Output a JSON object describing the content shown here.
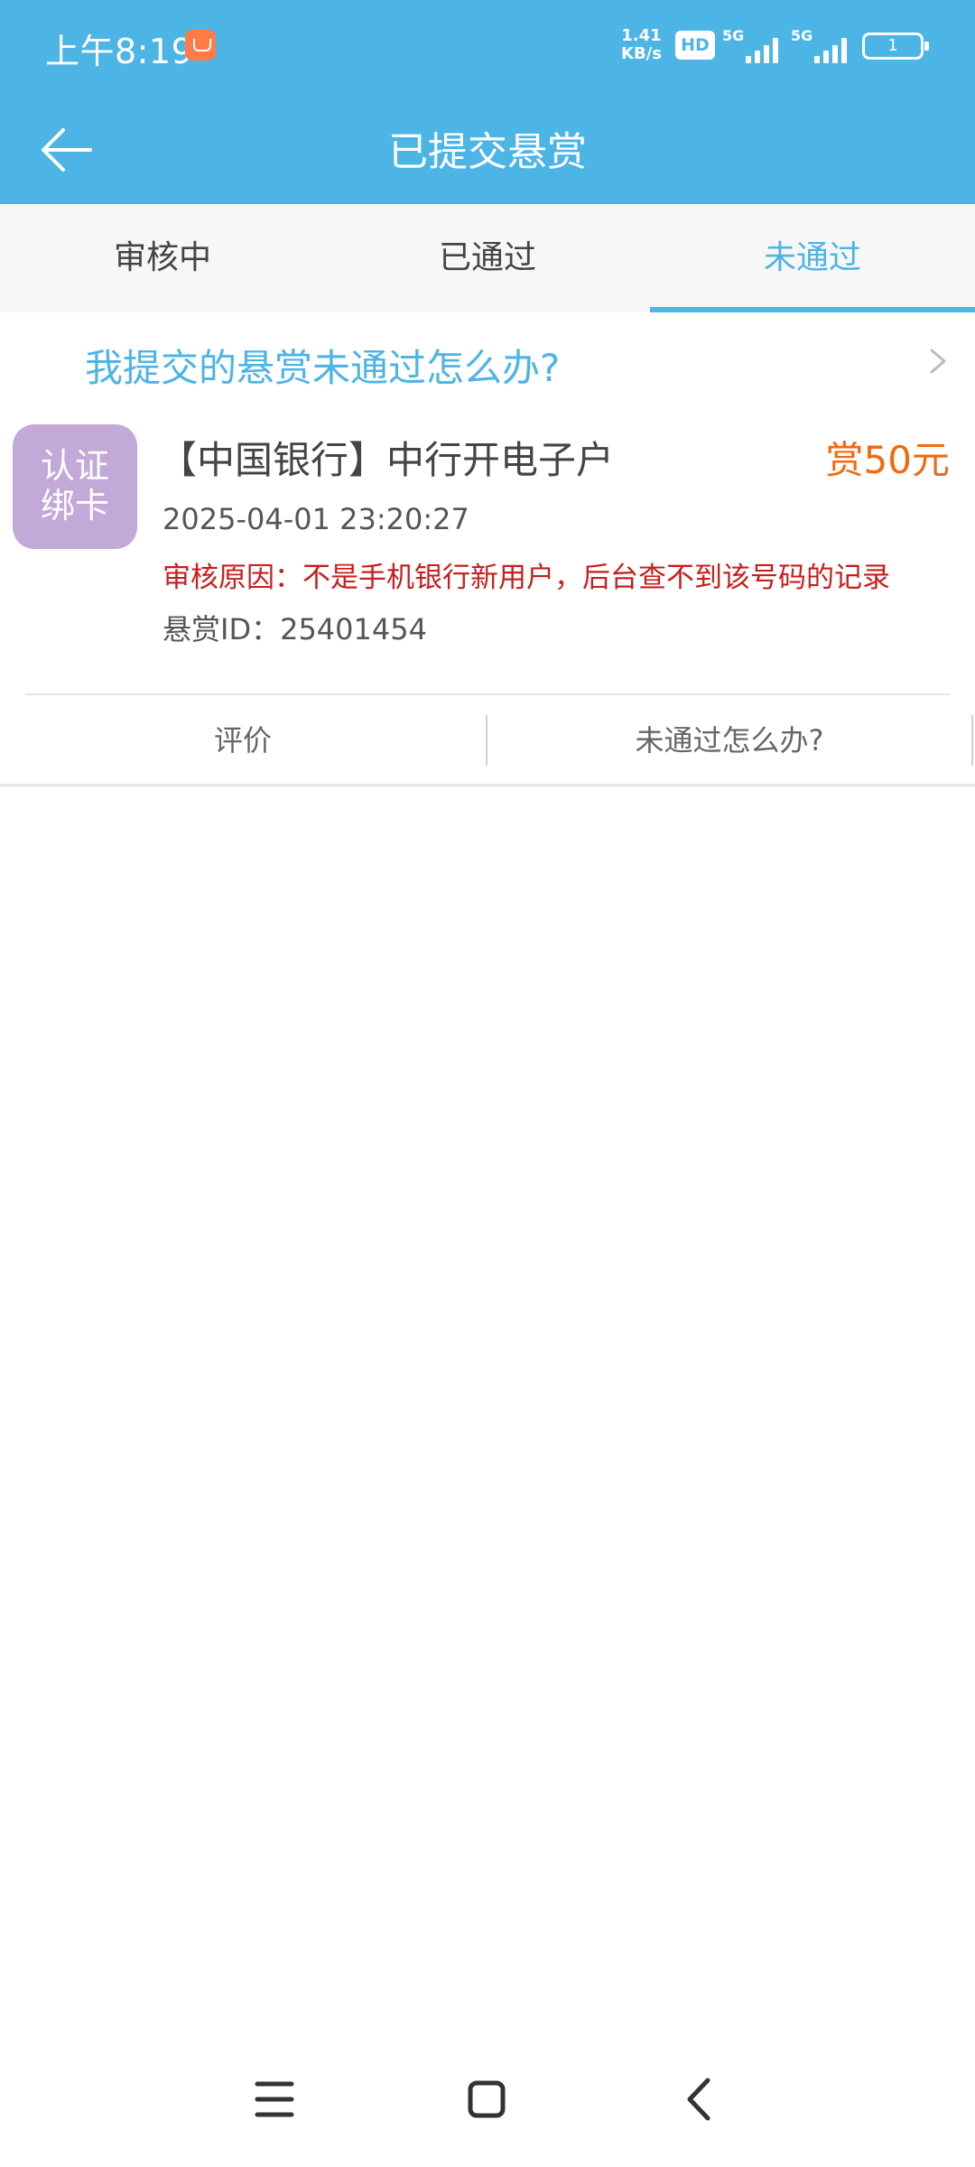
{
  "status_bar": {
    "time": "上午8:19",
    "net_speed_value": "1.41",
    "net_speed_unit": "KB/s",
    "hd_badge": "HD",
    "signal_1_label": "5G",
    "signal_2_label": "5G",
    "battery_level": "1"
  },
  "header": {
    "title": "已提交悬赏"
  },
  "tabs": [
    {
      "label": "审核中"
    },
    {
      "label": "已通过"
    },
    {
      "label": "未通过",
      "active": true
    }
  ],
  "help_banner": {
    "text": "我提交的悬赏未通过怎么办?"
  },
  "task": {
    "avatar_line1": "认证",
    "avatar_line2": "绑卡",
    "title": "【中国银行】中行开电子户",
    "reward": "赏50元",
    "time": "2025-04-01 23:20:27",
    "reason": "审核原因：不是手机银行新用户，后台查不到该号码的记录",
    "id": "悬赏ID：25401454"
  },
  "actions": {
    "review": "评价",
    "help": "未通过怎么办?"
  },
  "colors": {
    "primary": "#4db4e6",
    "reward": "#f06a0f",
    "error": "#c81e1e",
    "avatar_bg": "#c3a9d7"
  }
}
